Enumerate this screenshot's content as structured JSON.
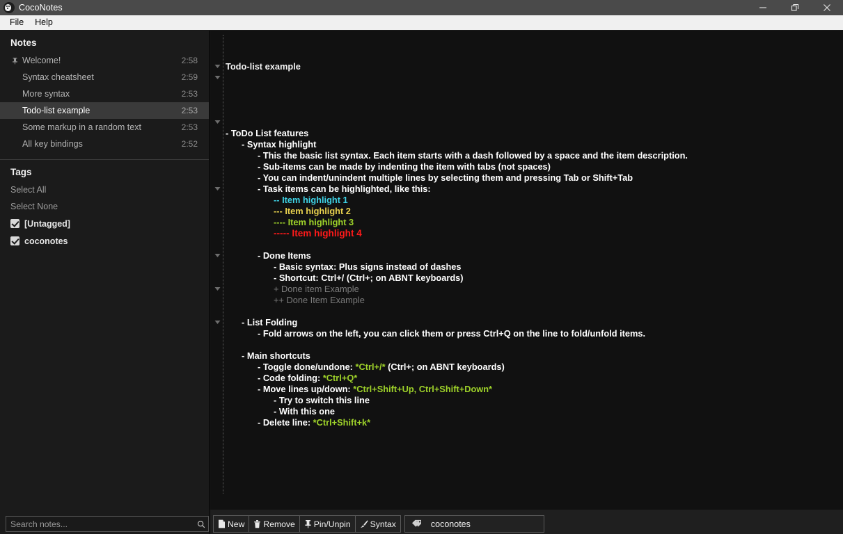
{
  "window": {
    "title": "CocoNotes",
    "icon": "coconut-icon",
    "controls": [
      {
        "name": "minimize-button",
        "glyph": "minimize-icon"
      },
      {
        "name": "maximize-button",
        "glyph": "restore-icon"
      },
      {
        "name": "close-button",
        "glyph": "close-icon"
      }
    ]
  },
  "menubar": {
    "items": [
      {
        "label": "File"
      },
      {
        "label": "Help"
      }
    ]
  },
  "sidebar": {
    "notes_title": "Notes",
    "notes": [
      {
        "name": "Welcome!",
        "time": "2:58",
        "pinned": true,
        "selected": false
      },
      {
        "name": "Syntax cheatsheet",
        "time": "2:59",
        "pinned": false,
        "selected": false
      },
      {
        "name": "More syntax",
        "time": "2:53",
        "pinned": false,
        "selected": false
      },
      {
        "name": "Todo-list example",
        "time": "2:53",
        "pinned": false,
        "selected": true
      },
      {
        "name": "Some markup in a random text",
        "time": "2:53",
        "pinned": false,
        "selected": false
      },
      {
        "name": "All key bindings",
        "time": "2:52",
        "pinned": false,
        "selected": false
      }
    ],
    "tags_title": "Tags",
    "select_all": "Select All",
    "select_none": "Select None",
    "tags": [
      {
        "label": "[Untagged]",
        "checked": true
      },
      {
        "label": "coconotes",
        "checked": true
      }
    ]
  },
  "editor": {
    "note_title": "Todo-list example",
    "lines": [
      {
        "indent": 0,
        "fold": false,
        "blank": false,
        "parts": [
          {
            "t": "- ToDo List features",
            "c": ""
          }
        ]
      },
      {
        "indent": 1,
        "fold": true,
        "blank": false,
        "parts": [
          {
            "t": "- Syntax highlight",
            "c": ""
          }
        ]
      },
      {
        "indent": 2,
        "fold": false,
        "blank": false,
        "parts": [
          {
            "t": "- This the basic list syntax. Each item starts with a dash followed by a space and the item description.",
            "c": ""
          }
        ]
      },
      {
        "indent": 2,
        "fold": false,
        "blank": false,
        "parts": [
          {
            "t": "- Sub-items can be made by indenting the item with tabs (not spaces)",
            "c": ""
          }
        ]
      },
      {
        "indent": 2,
        "fold": false,
        "blank": false,
        "parts": [
          {
            "t": "- You can indent/unindent multiple lines by selecting them and pressing Tab or Shift+Tab",
            "c": ""
          }
        ]
      },
      {
        "indent": 2,
        "fold": true,
        "blank": false,
        "parts": [
          {
            "t": "- Task items can be highlighted, like this:",
            "c": ""
          }
        ]
      },
      {
        "indent": 3,
        "fold": false,
        "blank": false,
        "parts": [
          {
            "t": "-- Item highlight 1",
            "c": "c-cyan"
          }
        ]
      },
      {
        "indent": 3,
        "fold": false,
        "blank": false,
        "parts": [
          {
            "t": "--- Item highlight 2",
            "c": "c-gold"
          }
        ]
      },
      {
        "indent": 3,
        "fold": false,
        "blank": false,
        "parts": [
          {
            "t": "---- Item highlight 3",
            "c": "c-green"
          }
        ]
      },
      {
        "indent": 3,
        "fold": false,
        "blank": false,
        "parts": [
          {
            "t": "----- Item highlight 4",
            "c": "c-red"
          }
        ]
      },
      {
        "indent": 0,
        "fold": false,
        "blank": true,
        "parts": [
          {
            "t": " ",
            "c": ""
          }
        ]
      },
      {
        "indent": 2,
        "fold": true,
        "blank": false,
        "parts": [
          {
            "t": "- Done Items",
            "c": ""
          }
        ]
      },
      {
        "indent": 3,
        "fold": false,
        "blank": false,
        "parts": [
          {
            "t": "- Basic syntax: Plus signs instead of dashes",
            "c": ""
          }
        ]
      },
      {
        "indent": 3,
        "fold": false,
        "blank": false,
        "parts": [
          {
            "t": "- Shortcut: Ctrl+/ (Ctrl+; on ABNT keyboards)",
            "c": ""
          }
        ]
      },
      {
        "indent": 3,
        "fold": false,
        "blank": false,
        "parts": [
          {
            "t": "+ Done item Example",
            "c": "c-done"
          }
        ]
      },
      {
        "indent": 3,
        "fold": false,
        "blank": false,
        "parts": [
          {
            "t": "++ Done Item Example",
            "c": "c-done"
          }
        ]
      },
      {
        "indent": 0,
        "fold": false,
        "blank": true,
        "parts": [
          {
            "t": " ",
            "c": ""
          }
        ]
      },
      {
        "indent": 1,
        "fold": true,
        "blank": false,
        "parts": [
          {
            "t": "- List Folding",
            "c": ""
          }
        ]
      },
      {
        "indent": 2,
        "fold": false,
        "blank": false,
        "parts": [
          {
            "t": "- Fold arrows on the left, you can click them or press Ctrl+Q on the line to fold/unfold items.",
            "c": ""
          }
        ]
      },
      {
        "indent": 0,
        "fold": false,
        "blank": true,
        "parts": [
          {
            "t": " ",
            "c": ""
          }
        ]
      },
      {
        "indent": 1,
        "fold": true,
        "blank": false,
        "parts": [
          {
            "t": "- Main shortcuts",
            "c": ""
          }
        ]
      },
      {
        "indent": 2,
        "fold": false,
        "blank": false,
        "parts": [
          {
            "t": "- Toggle done/undone: ",
            "c": ""
          },
          {
            "t": "*Ctrl+/*",
            "c": "c-kbd"
          },
          {
            "t": " (Ctrl+; on ABNT keyboards)",
            "c": ""
          }
        ]
      },
      {
        "indent": 2,
        "fold": false,
        "blank": false,
        "parts": [
          {
            "t": "- Code folding: ",
            "c": ""
          },
          {
            "t": "*Ctrl+Q*",
            "c": "c-kbd"
          }
        ]
      },
      {
        "indent": 2,
        "fold": true,
        "blank": false,
        "parts": [
          {
            "t": "- Move lines up/down: ",
            "c": ""
          },
          {
            "t": "*Ctrl+Shift+Up, Ctrl+Shift+Down*",
            "c": "c-kbd"
          }
        ]
      },
      {
        "indent": 3,
        "fold": false,
        "blank": false,
        "parts": [
          {
            "t": "- Try to switch this line",
            "c": ""
          }
        ]
      },
      {
        "indent": 3,
        "fold": false,
        "blank": false,
        "parts": [
          {
            "t": "- With this one",
            "c": ""
          }
        ]
      },
      {
        "indent": 2,
        "fold": false,
        "blank": false,
        "parts": [
          {
            "t": "- Delete line: ",
            "c": ""
          },
          {
            "t": "*Ctrl+Shift+k*",
            "c": "c-kbd"
          }
        ]
      }
    ]
  },
  "bottom": {
    "search_placeholder": "Search notes...",
    "search_value": "",
    "buttons": [
      {
        "label": "New",
        "icon": "new-file-icon"
      },
      {
        "label": "Remove",
        "icon": "trash-icon"
      },
      {
        "label": "Pin/Unpin",
        "icon": "pin-icon"
      },
      {
        "label": "Syntax",
        "icon": "brush-icon"
      }
    ],
    "tag_field": {
      "label": "coconotes",
      "icon": "tag-icon"
    }
  },
  "colors": {
    "accent_green": "#9fd32a",
    "highlight_cyan": "#3fd3e6",
    "highlight_gold": "#e9d24f",
    "highlight_red": "#ff1a1a",
    "done_gray": "#7c7c7c",
    "selected_row": "#3a3a3a"
  }
}
